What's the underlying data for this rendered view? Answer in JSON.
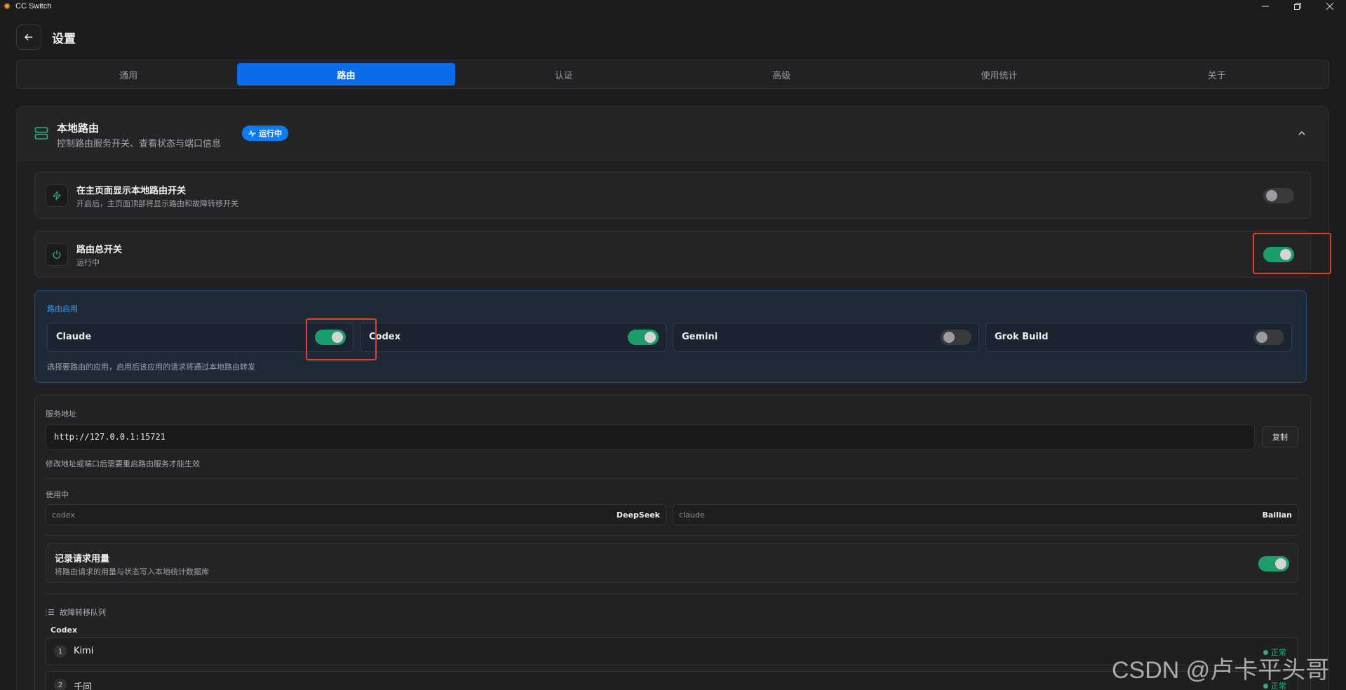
{
  "app": {
    "title": "CC Switch"
  },
  "header": {
    "title": "设置"
  },
  "tabs": [
    {
      "label": "通用"
    },
    {
      "label": "路由",
      "active": true
    },
    {
      "label": "认证"
    },
    {
      "label": "高级"
    },
    {
      "label": "使用统计"
    },
    {
      "label": "关于"
    }
  ],
  "section": {
    "title": "本地路由",
    "subtitle": "控制路由服务开关、查看状态与端口信息",
    "badge": "运行中"
  },
  "show_switch": {
    "title": "在主页面显示本地路由开关",
    "subtitle": "开启后，主页面顶部将显示路由和故障转移开关",
    "enabled": false
  },
  "master_switch": {
    "title": "路由总开关",
    "subtitle": "运行中",
    "enabled": true
  },
  "routing": {
    "label": "路由启用",
    "apps": [
      {
        "name": "Claude",
        "enabled": true
      },
      {
        "name": "Codex",
        "enabled": true
      },
      {
        "name": "Gemini",
        "enabled": false
      },
      {
        "name": "Grok Build",
        "enabled": false
      }
    ],
    "hint": "选择要路由的应用，启用后该应用的请求将通过本地路由转发"
  },
  "service": {
    "label": "服务地址",
    "address": "http://127.0.0.1:15721",
    "copy_label": "复制",
    "hint": "修改地址或端口后需要重启路由服务才能生效"
  },
  "in_use": {
    "label": "使用中",
    "items": [
      {
        "app": "codex",
        "provider": "DeepSeek"
      },
      {
        "app": "claude",
        "provider": "Bailian"
      }
    ]
  },
  "log_usage": {
    "title": "记录请求用量",
    "subtitle": "将路由请求的用量与状态写入本地统计数据库",
    "enabled": true
  },
  "failover": {
    "label": "故障转移队列",
    "group": "Codex",
    "items": [
      {
        "index": "1",
        "name": "Kimi",
        "status": "正常"
      },
      {
        "index": "2",
        "name": "千问",
        "status": "正常"
      }
    ]
  },
  "colors": {
    "accent": "#0a6ce8",
    "toggle_on": "#1d9d6b",
    "highlight": "#e0402a"
  },
  "watermark": "CSDN @卢卡平头哥"
}
